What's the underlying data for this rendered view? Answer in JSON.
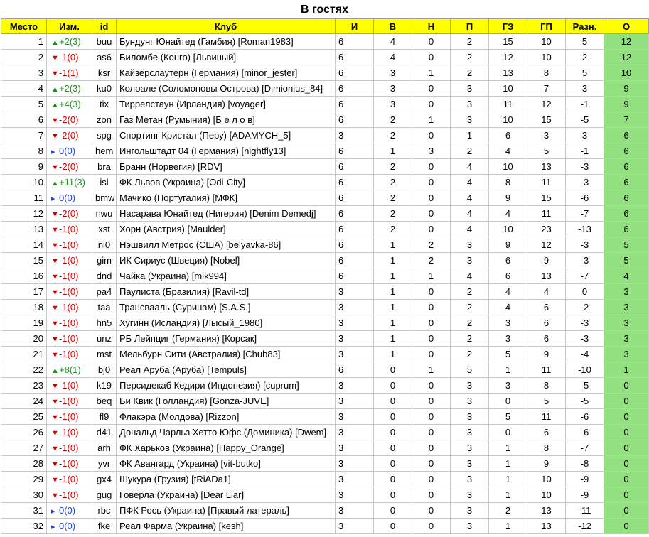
{
  "title": "В гостях",
  "headers": [
    "Место",
    "Изм.",
    "id",
    "Клуб",
    "И",
    "В",
    "Н",
    "П",
    "ГЗ",
    "ГП",
    "Разн.",
    "О"
  ],
  "colors": {
    "header_bg": "#ffff00",
    "points_bg": "#92e07f",
    "up": "#1e8c1e",
    "down": "#d40000",
    "same": "#1f3fd0"
  },
  "rows": [
    {
      "place": "1",
      "dir": "up",
      "change": "+2(3)",
      "id": "buu",
      "club": "Бундунг Юнайтед (Гамбия) [Roman1983]",
      "games": "6",
      "w": "4",
      "d": "0",
      "l": "2",
      "gf": "15",
      "ga": "10",
      "diff": "5",
      "pts": "12"
    },
    {
      "place": "2",
      "dir": "down",
      "change": "-1(0)",
      "id": "as6",
      "club": "Биломбе (Конго) [Львиный]",
      "games": "6",
      "w": "4",
      "d": "0",
      "l": "2",
      "gf": "12",
      "ga": "10",
      "diff": "2",
      "pts": "12"
    },
    {
      "place": "3",
      "dir": "down",
      "change": "-1(1)",
      "id": "ksr",
      "club": "Кайзерслаутерн (Германия) [minor_jester]",
      "games": "6",
      "w": "3",
      "d": "1",
      "l": "2",
      "gf": "13",
      "ga": "8",
      "diff": "5",
      "pts": "10"
    },
    {
      "place": "4",
      "dir": "up",
      "change": "+2(3)",
      "id": "ku0",
      "club": "Колоале (Соломоновы Острова) [Dimionius_84]",
      "games": "6",
      "w": "3",
      "d": "0",
      "l": "3",
      "gf": "10",
      "ga": "7",
      "diff": "3",
      "pts": "9"
    },
    {
      "place": "5",
      "dir": "up",
      "change": "+4(3)",
      "id": "tix",
      "club": "Тиррелстаун (Ирландия) [voyager]",
      "games": "6",
      "w": "3",
      "d": "0",
      "l": "3",
      "gf": "11",
      "ga": "12",
      "diff": "-1",
      "pts": "9"
    },
    {
      "place": "6",
      "dir": "down",
      "change": "-2(0)",
      "id": "zon",
      "club": "Газ Метан (Румыния) [Б е л о в]",
      "games": "6",
      "w": "2",
      "d": "1",
      "l": "3",
      "gf": "10",
      "ga": "15",
      "diff": "-5",
      "pts": "7"
    },
    {
      "place": "7",
      "dir": "down",
      "change": "-2(0)",
      "id": "spg",
      "club": "Спортинг Кристал (Перу) [ADAMYCH_5]",
      "games": "3",
      "w": "2",
      "d": "0",
      "l": "1",
      "gf": "6",
      "ga": "3",
      "diff": "3",
      "pts": "6"
    },
    {
      "place": "8",
      "dir": "same",
      "change": "0(0)",
      "id": "hem",
      "club": "Ингольштадт 04 (Германия) [nightfly13]",
      "games": "6",
      "w": "1",
      "d": "3",
      "l": "2",
      "gf": "4",
      "ga": "5",
      "diff": "-1",
      "pts": "6"
    },
    {
      "place": "9",
      "dir": "down",
      "change": "-2(0)",
      "id": "bra",
      "club": "Бранн (Норвегия) [RDV]",
      "games": "6",
      "w": "2",
      "d": "0",
      "l": "4",
      "gf": "10",
      "ga": "13",
      "diff": "-3",
      "pts": "6"
    },
    {
      "place": "10",
      "dir": "up",
      "change": "+11(3)",
      "id": "isi",
      "club": "ФК Львов (Украина) [Odi-City]",
      "games": "6",
      "w": "2",
      "d": "0",
      "l": "4",
      "gf": "8",
      "ga": "11",
      "diff": "-3",
      "pts": "6"
    },
    {
      "place": "11",
      "dir": "same",
      "change": "0(0)",
      "id": "bmw",
      "club": "Мачико (Португалия) [МФК]",
      "games": "6",
      "w": "2",
      "d": "0",
      "l": "4",
      "gf": "9",
      "ga": "15",
      "diff": "-6",
      "pts": "6"
    },
    {
      "place": "12",
      "dir": "down",
      "change": "-2(0)",
      "id": "nwu",
      "club": "Насарава Юнайтед (Нигерия) [Denim Demedj]",
      "games": "6",
      "w": "2",
      "d": "0",
      "l": "4",
      "gf": "4",
      "ga": "11",
      "diff": "-7",
      "pts": "6"
    },
    {
      "place": "13",
      "dir": "down",
      "change": "-1(0)",
      "id": "xst",
      "club": "Хорн (Австрия) [Maulder]",
      "games": "6",
      "w": "2",
      "d": "0",
      "l": "4",
      "gf": "10",
      "ga": "23",
      "diff": "-13",
      "pts": "6"
    },
    {
      "place": "14",
      "dir": "down",
      "change": "-1(0)",
      "id": "nl0",
      "club": "Нэшвилл Метрос (США) [belyavka-86]",
      "games": "6",
      "w": "1",
      "d": "2",
      "l": "3",
      "gf": "9",
      "ga": "12",
      "diff": "-3",
      "pts": "5"
    },
    {
      "place": "15",
      "dir": "down",
      "change": "-1(0)",
      "id": "gim",
      "club": "ИК Сириус (Швеция) [Nobel]",
      "games": "6",
      "w": "1",
      "d": "2",
      "l": "3",
      "gf": "6",
      "ga": "9",
      "diff": "-3",
      "pts": "5"
    },
    {
      "place": "16",
      "dir": "down",
      "change": "-1(0)",
      "id": "dnd",
      "club": "Чайка (Украина) [mik994]",
      "games": "6",
      "w": "1",
      "d": "1",
      "l": "4",
      "gf": "6",
      "ga": "13",
      "diff": "-7",
      "pts": "4"
    },
    {
      "place": "17",
      "dir": "down",
      "change": "-1(0)",
      "id": "pa4",
      "club": "Паулиста (Бразилия) [Ravil-td]",
      "games": "3",
      "w": "1",
      "d": "0",
      "l": "2",
      "gf": "4",
      "ga": "4",
      "diff": "0",
      "pts": "3"
    },
    {
      "place": "18",
      "dir": "down",
      "change": "-1(0)",
      "id": "taa",
      "club": "Трансвааль (Суринам) [S.A.S.]",
      "games": "3",
      "w": "1",
      "d": "0",
      "l": "2",
      "gf": "4",
      "ga": "6",
      "diff": "-2",
      "pts": "3"
    },
    {
      "place": "19",
      "dir": "down",
      "change": "-1(0)",
      "id": "hn5",
      "club": "Хугинн (Исландия) [Лысый_1980]",
      "games": "3",
      "w": "1",
      "d": "0",
      "l": "2",
      "gf": "3",
      "ga": "6",
      "diff": "-3",
      "pts": "3"
    },
    {
      "place": "20",
      "dir": "down",
      "change": "-1(0)",
      "id": "unz",
      "club": "РБ Лейпциг (Германия) [Корсак]",
      "games": "3",
      "w": "1",
      "d": "0",
      "l": "2",
      "gf": "3",
      "ga": "6",
      "diff": "-3",
      "pts": "3"
    },
    {
      "place": "21",
      "dir": "down",
      "change": "-1(0)",
      "id": "mst",
      "club": "Мельбурн Сити (Австралия) [Chub83]",
      "games": "3",
      "w": "1",
      "d": "0",
      "l": "2",
      "gf": "5",
      "ga": "9",
      "diff": "-4",
      "pts": "3"
    },
    {
      "place": "22",
      "dir": "up",
      "change": "+8(1)",
      "id": "bj0",
      "club": "Реал Аруба (Аруба) [Tempuls]",
      "games": "6",
      "w": "0",
      "d": "1",
      "l": "5",
      "gf": "1",
      "ga": "11",
      "diff": "-10",
      "pts": "1"
    },
    {
      "place": "23",
      "dir": "down",
      "change": "-1(0)",
      "id": "k19",
      "club": "Персидекаб Кедири (Индонезия) [cuprum]",
      "games": "3",
      "w": "0",
      "d": "0",
      "l": "3",
      "gf": "3",
      "ga": "8",
      "diff": "-5",
      "pts": "0"
    },
    {
      "place": "24",
      "dir": "down",
      "change": "-1(0)",
      "id": "beq",
      "club": "Би Квик (Голландия) [Gonza-JUVE]",
      "games": "3",
      "w": "0",
      "d": "0",
      "l": "3",
      "gf": "0",
      "ga": "5",
      "diff": "-5",
      "pts": "0"
    },
    {
      "place": "25",
      "dir": "down",
      "change": "-1(0)",
      "id": "fl9",
      "club": "Флакэра (Молдова) [Rizzon]",
      "games": "3",
      "w": "0",
      "d": "0",
      "l": "3",
      "gf": "5",
      "ga": "11",
      "diff": "-6",
      "pts": "0"
    },
    {
      "place": "26",
      "dir": "down",
      "change": "-1(0)",
      "id": "d41",
      "club": "Дональд Чарльз Хетто Юфс (Доминика) [Dwem]",
      "games": "3",
      "w": "0",
      "d": "0",
      "l": "3",
      "gf": "0",
      "ga": "6",
      "diff": "-6",
      "pts": "0"
    },
    {
      "place": "27",
      "dir": "down",
      "change": "-1(0)",
      "id": "arh",
      "club": "ФК Харьков (Украина) [Happy_Orange]",
      "games": "3",
      "w": "0",
      "d": "0",
      "l": "3",
      "gf": "1",
      "ga": "8",
      "diff": "-7",
      "pts": "0"
    },
    {
      "place": "28",
      "dir": "down",
      "change": "-1(0)",
      "id": "yvr",
      "club": "ФК Авангард (Украина) [vit-butko]",
      "games": "3",
      "w": "0",
      "d": "0",
      "l": "3",
      "gf": "1",
      "ga": "9",
      "diff": "-8",
      "pts": "0"
    },
    {
      "place": "29",
      "dir": "down",
      "change": "-1(0)",
      "id": "gx4",
      "club": "Шукура (Грузия) [tRiADa1]",
      "games": "3",
      "w": "0",
      "d": "0",
      "l": "3",
      "gf": "1",
      "ga": "10",
      "diff": "-9",
      "pts": "0"
    },
    {
      "place": "30",
      "dir": "down",
      "change": "-1(0)",
      "id": "gug",
      "club": "Говерла (Украина) [Dear Liar]",
      "games": "3",
      "w": "0",
      "d": "0",
      "l": "3",
      "gf": "1",
      "ga": "10",
      "diff": "-9",
      "pts": "0"
    },
    {
      "place": "31",
      "dir": "same",
      "change": "0(0)",
      "id": "rbc",
      "club": "ПФК Рось (Украина) [Правый латераль]",
      "games": "3",
      "w": "0",
      "d": "0",
      "l": "3",
      "gf": "2",
      "ga": "13",
      "diff": "-11",
      "pts": "0"
    },
    {
      "place": "32",
      "dir": "same",
      "change": "0(0)",
      "id": "fke",
      "club": "Реал Фарма (Украина) [kesh]",
      "games": "3",
      "w": "0",
      "d": "0",
      "l": "3",
      "gf": "1",
      "ga": "13",
      "diff": "-12",
      "pts": "0"
    }
  ]
}
